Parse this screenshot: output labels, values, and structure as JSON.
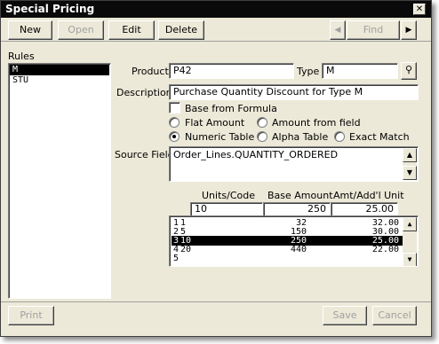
{
  "window": {
    "title": "Special Pricing",
    "close": "✕"
  },
  "toolbar": {
    "new": "New",
    "open": "Open",
    "edit": "Edit",
    "delete": "Delete",
    "prev": "◀",
    "find": "Find",
    "next": "▶"
  },
  "rules": {
    "label": "Rules",
    "items": [
      "M",
      "STU"
    ],
    "selected_index": 0
  },
  "form": {
    "product_label": "Product",
    "product_value": "P42",
    "type_label": "Type",
    "type_value": "M",
    "description_label": "Description",
    "description_value": "Purchase Quantity Discount for Type M",
    "base_formula_label": "Base from Formula",
    "radios": {
      "flat_amount": "Flat Amount",
      "amount_from_field": "Amount from field",
      "numeric_table": "Numeric Table",
      "alpha_table": "Alpha Table",
      "exact_match": "Exact Match",
      "selected": "numeric_table"
    },
    "source_field_label": "Source Field",
    "source_field_value": "Order_Lines.QUANTITY_ORDERED"
  },
  "table": {
    "headers": [
      "Units/Code",
      "Base Amount",
      "Amt/Add'l Unit"
    ],
    "edit_row": [
      "10",
      "250",
      "25.00"
    ],
    "rows": [
      [
        "1",
        "1",
        "32",
        "32.00"
      ],
      [
        "2",
        "5",
        "150",
        "30.00"
      ],
      [
        "3",
        "10",
        "250",
        "25.00"
      ],
      [
        "4",
        "20",
        "440",
        "22.00"
      ],
      [
        "5",
        "",
        "",
        ""
      ]
    ],
    "selected_index": 2
  },
  "footer": {
    "print": "Print",
    "save": "Save",
    "cancel": "Cancel"
  }
}
